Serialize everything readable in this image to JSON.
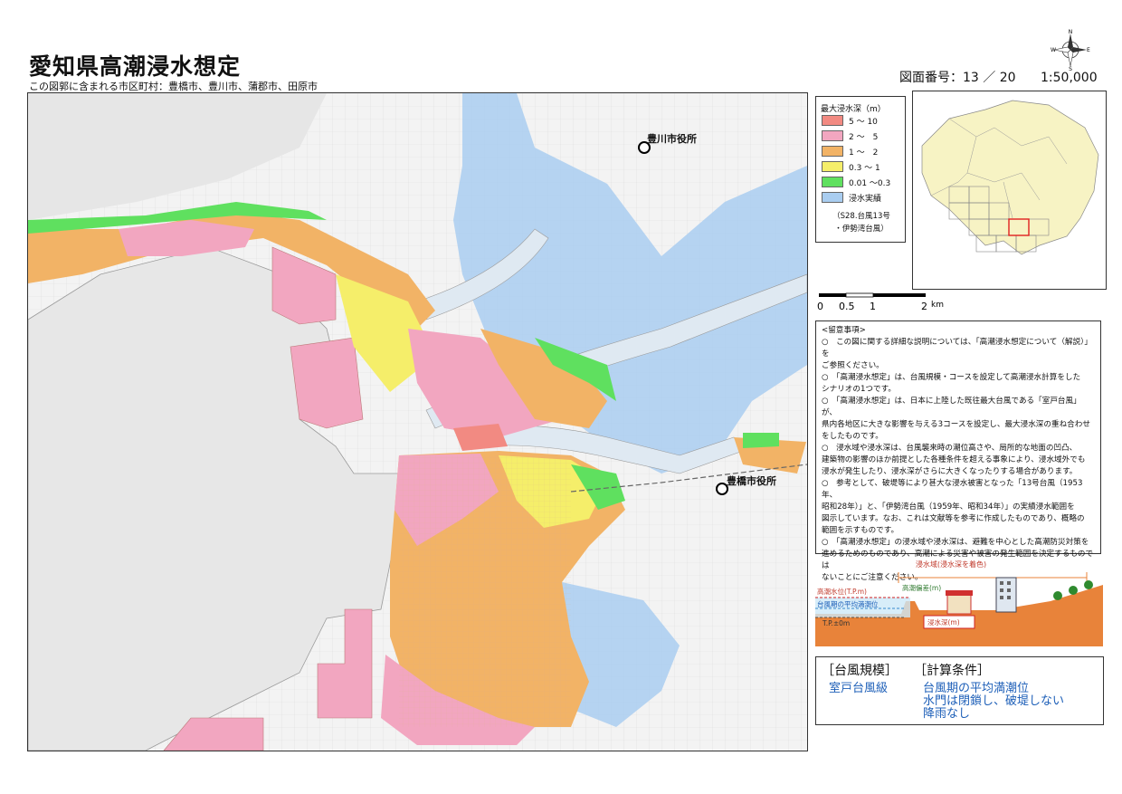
{
  "header": {
    "title": "愛知県高潮浸水想定",
    "subtitle": "この図郭に含まれる市区町村：豊橋市、豊川市、蒲郡市、田原市",
    "sheet_number": "図面番号：13 ／ 20",
    "scale": "1:50,000"
  },
  "compass": {
    "n": "N",
    "e": "E",
    "s": "S",
    "w": "W"
  },
  "map": {
    "labels": [
      {
        "id": "toyokawa-city-hall",
        "text": "豊川市役所"
      },
      {
        "id": "toyohashi-city-hall",
        "text": "豊橋市役所"
      }
    ]
  },
  "legend": {
    "title": "最大浸水深（m）",
    "items": [
      {
        "label": "5 ～ 10",
        "color": "#f28a82"
      },
      {
        "label": "2 ～　5",
        "color": "#f2a6c0"
      },
      {
        "label": "1 ～　2",
        "color": "#f2b366"
      },
      {
        "label": "0.3 ～ 1",
        "color": "#f5ee6a"
      },
      {
        "label": "0.01 ～0.3",
        "color": "#5fe05f"
      },
      {
        "label": "浸水実績",
        "color": "#a9cdf0"
      }
    ],
    "note_line1": "（S28.台風13号",
    "note_line2": "・伊勢湾台風）"
  },
  "scalebar": {
    "t0": "0",
    "t1": "0.5",
    "t2": "1",
    "t3": "2",
    "unit": "km"
  },
  "notes": {
    "heading": "<留意事項>",
    "lines": [
      "○　この図に関する詳細な説明については、「高潮浸水想定について（解説）」を",
      "ご参照ください。",
      "○　「高潮浸水想定」は、台風規模・コースを設定して高潮浸水計算をした",
      "シナリオの1つです。",
      "○　「高潮浸水想定」は、日本に上陸した既往最大台風である「室戸台風」が、",
      "県内各地区に大きな影響を与える3コースを設定し、最大浸水深の重ね合わせ",
      "をしたものです。",
      "○　浸水域や浸水深は、台風襲来時の潮位高さや、局所的な地面の凹凸、",
      "建築物の影響のほか前提とした各種条件を超える事象により、浸水域外でも",
      "浸水が発生したり、浸水深がさらに大きくなったりする場合があります。",
      "○　参考として、破堤等により甚大な浸水被害となった「13号台風（1953年、",
      "昭和28年）」と、「伊勢湾台風（1959年、昭和34年）」の実績浸水範囲を",
      "図示しています。なお、これは文献等を参考に作成したものであり、概略の",
      "範囲を示すものです。",
      "○　「高潮浸水想定」の浸水域や浸水深は、避難を中心とした高潮防災対策を",
      "進めるためのものであり、高潮による災害や被害の発生範囲を決定するものでは",
      "ないことにご注意ください。"
    ]
  },
  "diagram": {
    "inundation_area": "浸水域(浸水深を着色)",
    "tide_level": "高潮水位(T.P.m)",
    "tide_diff": "高潮偏差(m)",
    "mean_tide": "台風期の平均満潮位",
    "tp_zero": "T.P.±0m",
    "depth": "浸水深(m)"
  },
  "conditions": {
    "scale_header": "［台風規模］",
    "calc_header": "［計算条件］",
    "scale_value": "室戸台風級",
    "calc_lines": [
      "台風期の平均満潮位",
      "水門は閉鎖し、破堤しない",
      "降雨なし"
    ]
  }
}
